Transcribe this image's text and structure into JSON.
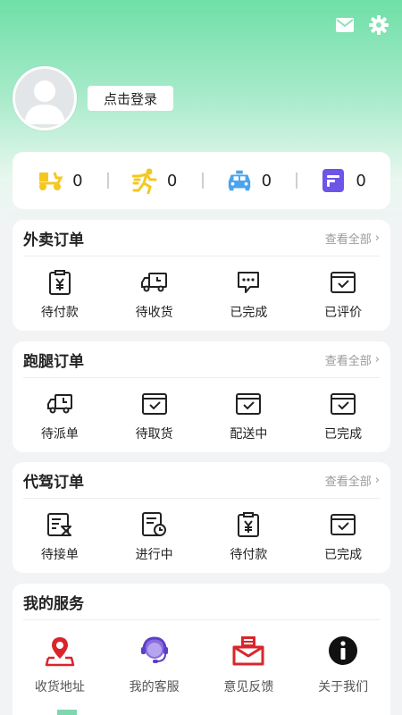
{
  "header": {
    "icons": [
      "mail-icon",
      "gear-icon"
    ]
  },
  "profile": {
    "login_label": "点击登录"
  },
  "stats": [
    {
      "icon": "scooter-icon",
      "count": "0",
      "color": "#f4c81e"
    },
    {
      "icon": "runner-icon",
      "count": "0",
      "color": "#f4c81e"
    },
    {
      "icon": "taxi-icon",
      "count": "0",
      "color": "#4aa3f0"
    },
    {
      "icon": "note-icon",
      "count": "0",
      "color": "#6d55e8"
    }
  ],
  "takeout": {
    "title": "外卖订单",
    "view_all": "查看全部",
    "items": [
      "待付款",
      "待收货",
      "已完成",
      "已评价"
    ]
  },
  "errand": {
    "title": "跑腿订单",
    "view_all": "查看全部",
    "items": [
      "待派单",
      "待取货",
      "配送中",
      "已完成"
    ]
  },
  "driver": {
    "title": "代驾订单",
    "view_all": "查看全部",
    "items": [
      "待接单",
      "进行中",
      "待付款",
      "已完成"
    ]
  },
  "services": {
    "title": "我的服务",
    "items": [
      "收货地址",
      "我的客服",
      "意见反馈",
      "关于我们"
    ]
  },
  "colors": {
    "accent_green": "#6fdfa7",
    "location_red": "#d8262c",
    "service_purple": "#8a6ce0",
    "feedback_red": "#d8262c"
  }
}
